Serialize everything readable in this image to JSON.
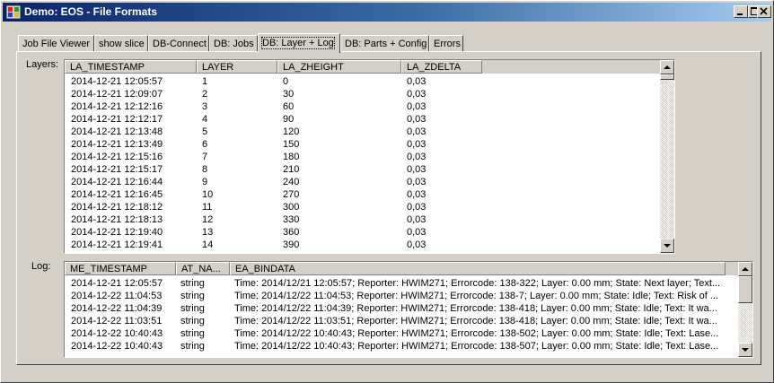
{
  "window": {
    "title": "Demo: EOS - File Formats"
  },
  "tabs": [
    {
      "label": "Job File Viewer",
      "active": false
    },
    {
      "label": "show slice",
      "active": false
    },
    {
      "label": "DB-Connect",
      "active": false
    },
    {
      "label": "DB: Jobs",
      "active": false
    },
    {
      "label": "DB: Layer + Log",
      "active": true
    },
    {
      "label": "DB: Parts + Config",
      "active": false
    },
    {
      "label": "Errors",
      "active": false
    }
  ],
  "layers": {
    "label": "Layers:",
    "columns": [
      "LA_TIMESTAMP",
      "LAYER",
      "LA_ZHEIGHT",
      "LA_ZDELTA"
    ],
    "rows": [
      [
        "2014-12-21 12:05:57",
        "1",
        "0",
        "0,03"
      ],
      [
        "2014-12-21 12:09:07",
        "2",
        "30",
        "0,03"
      ],
      [
        "2014-12-21 12:12:16",
        "3",
        "60",
        "0,03"
      ],
      [
        "2014-12-21 12:12:17",
        "4",
        "90",
        "0,03"
      ],
      [
        "2014-12-21 12:13:48",
        "5",
        "120",
        "0,03"
      ],
      [
        "2014-12-21 12:13:49",
        "6",
        "150",
        "0,03"
      ],
      [
        "2014-12-21 12:15:16",
        "7",
        "180",
        "0,03"
      ],
      [
        "2014-12-21 12:15:17",
        "8",
        "210",
        "0,03"
      ],
      [
        "2014-12-21 12:16:44",
        "9",
        "240",
        "0,03"
      ],
      [
        "2014-12-21 12:16:45",
        "10",
        "270",
        "0,03"
      ],
      [
        "2014-12-21 12:18:12",
        "11",
        "300",
        "0,03"
      ],
      [
        "2014-12-21 12:18:13",
        "12",
        "330",
        "0,03"
      ],
      [
        "2014-12-21 12:19:40",
        "13",
        "360",
        "0,03"
      ],
      [
        "2014-12-21 12:19:41",
        "14",
        "390",
        "0,03"
      ]
    ]
  },
  "log": {
    "label": "Log:",
    "columns": [
      "ME_TIMESTAMP",
      "AT_NA...",
      "EA_BINDATA"
    ],
    "rows": [
      [
        "2014-12-21 12:05:57",
        "string",
        "Time: 2014/12/21 12:05:57; Reporter: HWIM271; Errorcode: 138-322;  Layer:    0.00 mm; State: Next layer; Text..."
      ],
      [
        "2014-12-22 11:04:53",
        "string",
        "Time: 2014/12/22 11:04:53; Reporter: HWIM271; Errorcode: 138-7;  Layer:    0.00 mm; State: Idle; Text: Risk of ..."
      ],
      [
        "2014-12-22 11:04:39",
        "string",
        "Time: 2014/12/22 11:04:39; Reporter: HWIM271; Errorcode: 138-418;  Layer:    0.00 mm; State: Idle; Text: It wa..."
      ],
      [
        "2014-12-22 11:03:51",
        "string",
        "Time: 2014/12/22 11:03:51; Reporter: HWIM271; Errorcode: 138-418;  Layer:    0.00 mm; State: Idle; Text: It wa..."
      ],
      [
        "2014-12-22 10:40:43",
        "string",
        "Time: 2014/12/22 10:40:43; Reporter: HWIM271; Errorcode: 138-502;  Layer:    0.00 mm; State: Idle; Text: Lase..."
      ],
      [
        "2014-12-22 10:40:43",
        "string",
        "Time: 2014/12/22 10:40:43; Reporter: HWIM271; Errorcode: 138-507;  Layer:    0.00 mm; State: Idle; Text: Lase..."
      ]
    ]
  }
}
